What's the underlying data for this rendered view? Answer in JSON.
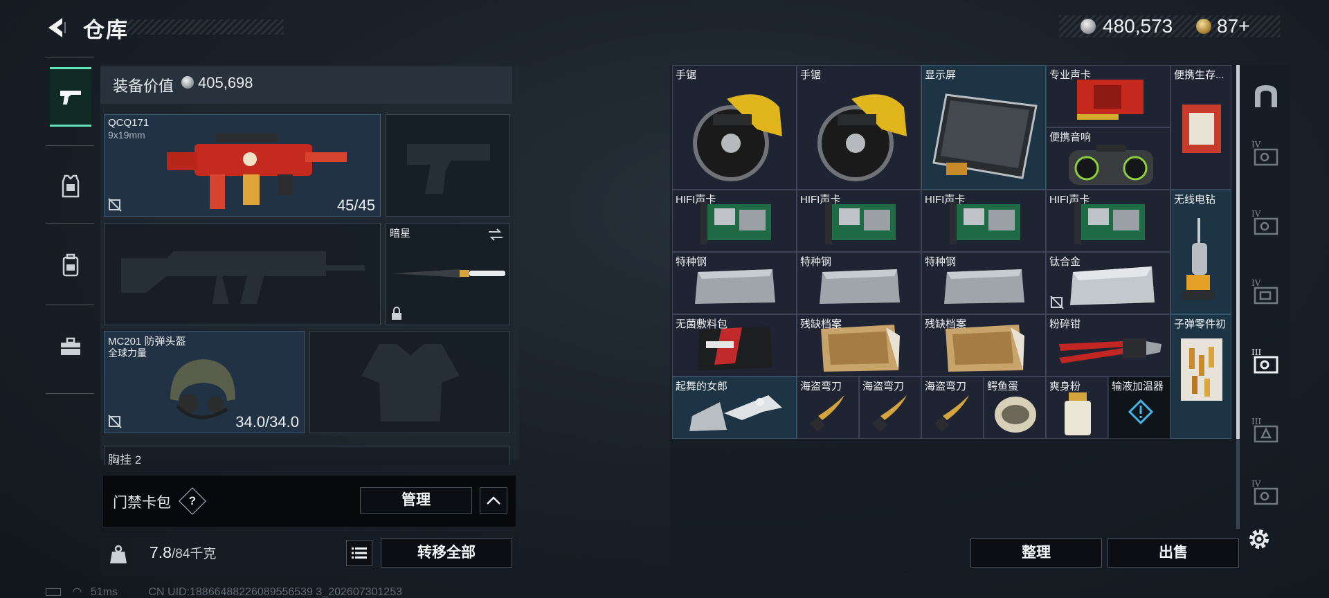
{
  "header": {
    "title": "仓库",
    "money": "480,573",
    "coins": "87",
    "coins_add": "+"
  },
  "left_nav": {
    "tabs": [
      {
        "icon": "gun-icon",
        "active": true
      },
      {
        "icon": "armor-vest-icon",
        "active": false
      },
      {
        "icon": "backpack-icon",
        "active": false
      },
      {
        "icon": "briefcase-icon",
        "active": false
      }
    ]
  },
  "loadout": {
    "value_label": "装备价值",
    "value": "405,698",
    "primary": {
      "name": "QCQ171",
      "caliber": "9x19mm",
      "ammo": "45/45"
    },
    "melee": {
      "name": "暗星"
    },
    "helmet": {
      "name": "MC201 防弹头盔",
      "maker": "全球力量",
      "durability": "34.0/34.0"
    },
    "next_section": "胸挂",
    "next_section_count": "2"
  },
  "keycard": {
    "label": "门禁卡包",
    "help": "?",
    "manage": "管理"
  },
  "weight": {
    "current": "7.8",
    "max": "/84千克",
    "transfer_all": "转移全部"
  },
  "status": {
    "ping": "51ms",
    "uid": "CN UID:18866488226089556539 3_202607301253"
  },
  "storage": {
    "items": [
      {
        "name": "手锯"
      },
      {
        "name": "手锯"
      },
      {
        "name": "显示屏"
      },
      {
        "name": "专业声卡"
      },
      {
        "name": "便携生存..."
      },
      {
        "name": "便携音响"
      },
      {
        "name": "HIFI声卡"
      },
      {
        "name": "HIFI声卡"
      },
      {
        "name": "HIFI声卡"
      },
      {
        "name": "HIFI声卡"
      },
      {
        "name": "无线电钻"
      },
      {
        "name": "特种钢"
      },
      {
        "name": "特种钢"
      },
      {
        "name": "特种钢"
      },
      {
        "name": "钛合金"
      },
      {
        "name": "无菌敷料包"
      },
      {
        "name": "残缺档案"
      },
      {
        "name": "残缺档案"
      },
      {
        "name": "粉碎钳"
      },
      {
        "name": "子弹零件初"
      },
      {
        "name": "起舞的女郎"
      },
      {
        "name": "海盗弯刀"
      },
      {
        "name": "海盗弯刀"
      },
      {
        "name": "海盗弯刀"
      },
      {
        "name": "鳄鱼蛋"
      },
      {
        "name": "爽身粉"
      },
      {
        "name": "输液加温器"
      }
    ],
    "sort": "整理",
    "sell": "出售"
  },
  "right_nav": {
    "tabs": [
      {
        "icon": "storage-home-icon",
        "roman": ""
      },
      {
        "icon": "storage-page-icon",
        "roman": "IV"
      },
      {
        "icon": "storage-page-icon",
        "roman": "IV"
      },
      {
        "icon": "storage-page-icon",
        "roman": "IV"
      },
      {
        "icon": "storage-page-icon",
        "roman": "III"
      },
      {
        "icon": "storage-page-icon",
        "roman": "III"
      },
      {
        "icon": "storage-page-icon",
        "roman": "IV"
      }
    ]
  },
  "colors": {
    "accent": "#5fe3b8",
    "blue_cell": "#1c3444",
    "item_cell": "#1f2433",
    "alert": "#3fb6e8"
  }
}
